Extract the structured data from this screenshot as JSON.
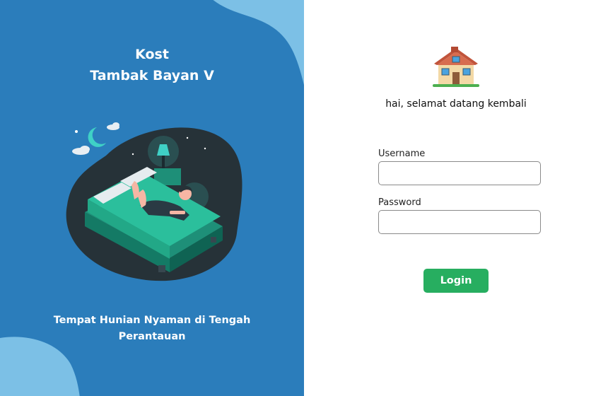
{
  "brand": {
    "name_line1": "Kost",
    "name_line2": "Tambak Bayan V",
    "tagline": "Tempat Hunian Nyaman di Tengah Perantauan"
  },
  "login": {
    "welcome_text": "hai, selamat datang kembali",
    "username_label": "Username",
    "username_value": "",
    "password_label": "Password",
    "password_value": "",
    "login_button_label": "Login"
  },
  "icons": {
    "header_icon": "house-icon",
    "illustration": "person-lying-on-bed-illustration"
  },
  "colors": {
    "left_panel_bg": "#2b7dbb",
    "blob_light": "#7cc0e6",
    "login_button": "#27ae60"
  }
}
